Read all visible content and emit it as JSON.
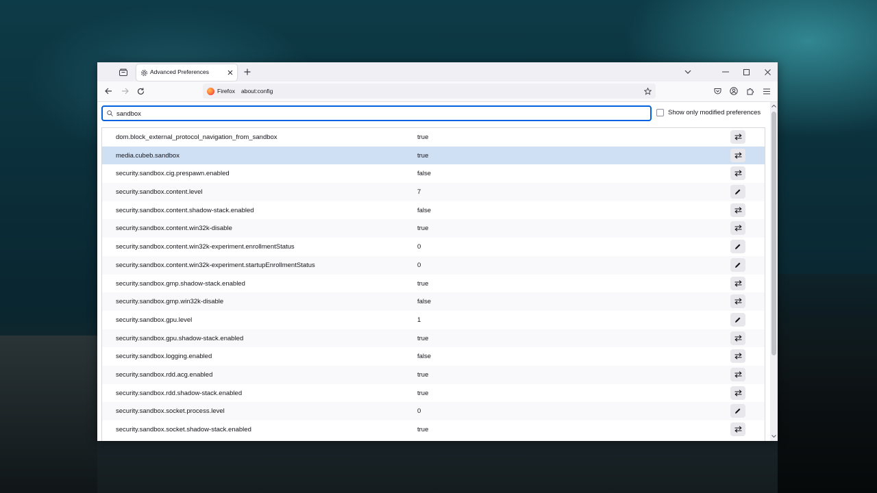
{
  "window": {
    "tab_title": "Advanced Preferences",
    "identity_label": "Firefox",
    "url": "about:config"
  },
  "search": {
    "value": "sandbox",
    "modified_only_label": "Show only modified preferences"
  },
  "icons": {
    "toggle": "toggle-arrows-icon",
    "edit": "pencil-icon"
  },
  "colors": {
    "accent": "#0061e0",
    "selected_row": "#cfe0f5"
  },
  "preferences": [
    {
      "name": "dom.block_external_protocol_navigation_from_sandbox",
      "value": "true",
      "action": "toggle"
    },
    {
      "name": "media.cubeb.sandbox",
      "value": "true",
      "action": "toggle"
    },
    {
      "name": "security.sandbox.cig.prespawn.enabled",
      "value": "false",
      "action": "toggle"
    },
    {
      "name": "security.sandbox.content.level",
      "value": "7",
      "action": "edit"
    },
    {
      "name": "security.sandbox.content.shadow-stack.enabled",
      "value": "false",
      "action": "toggle"
    },
    {
      "name": "security.sandbox.content.win32k-disable",
      "value": "true",
      "action": "toggle"
    },
    {
      "name": "security.sandbox.content.win32k-experiment.enrollmentStatus",
      "value": "0",
      "action": "edit"
    },
    {
      "name": "security.sandbox.content.win32k-experiment.startupEnrollmentStatus",
      "value": "0",
      "action": "edit"
    },
    {
      "name": "security.sandbox.gmp.shadow-stack.enabled",
      "value": "true",
      "action": "toggle"
    },
    {
      "name": "security.sandbox.gmp.win32k-disable",
      "value": "false",
      "action": "toggle"
    },
    {
      "name": "security.sandbox.gpu.level",
      "value": "1",
      "action": "edit"
    },
    {
      "name": "security.sandbox.gpu.shadow-stack.enabled",
      "value": "true",
      "action": "toggle"
    },
    {
      "name": "security.sandbox.logging.enabled",
      "value": "false",
      "action": "toggle"
    },
    {
      "name": "security.sandbox.rdd.acg.enabled",
      "value": "true",
      "action": "toggle"
    },
    {
      "name": "security.sandbox.rdd.shadow-stack.enabled",
      "value": "true",
      "action": "toggle"
    },
    {
      "name": "security.sandbox.socket.process.level",
      "value": "0",
      "action": "edit"
    },
    {
      "name": "security.sandbox.socket.shadow-stack.enabled",
      "value": "true",
      "action": "toggle"
    }
  ],
  "selected_index": 1
}
